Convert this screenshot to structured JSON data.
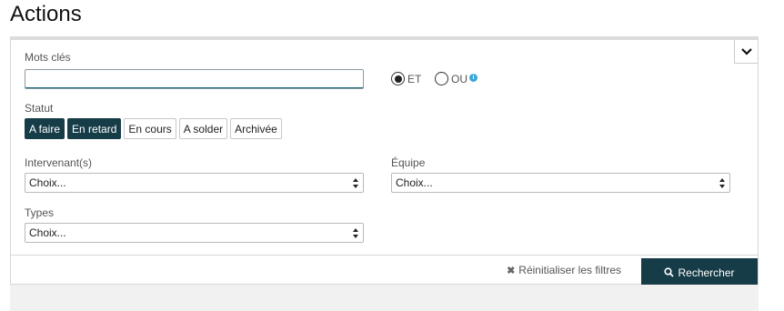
{
  "page": {
    "title": "Actions"
  },
  "filters": {
    "keywords": {
      "label": "Mots clés",
      "value": ""
    },
    "logic": {
      "et_label": "ET",
      "ou_label": "OU",
      "selected": "ET"
    },
    "status": {
      "label": "Statut",
      "options": [
        {
          "label": "A faire",
          "active": true
        },
        {
          "label": "En retard",
          "active": true
        },
        {
          "label": "En cours",
          "active": false
        },
        {
          "label": "A solder",
          "active": false
        },
        {
          "label": "Archivée",
          "active": false
        }
      ]
    },
    "intervenants": {
      "label": "Intervenant(s)",
      "value": "Choix..."
    },
    "equipe": {
      "label": "Équipe",
      "value": "Choix..."
    },
    "types": {
      "label": "Types",
      "value": "Choix..."
    }
  },
  "actions": {
    "reset_label": "Réinitialiser les filtres",
    "search_label": "Rechercher"
  },
  "icons": [
    "chevron-down-icon",
    "info-icon",
    "close-icon",
    "search-icon",
    "select-arrows-icon"
  ],
  "colors": {
    "accent": "#163c48",
    "info": "#3ba6d8"
  }
}
